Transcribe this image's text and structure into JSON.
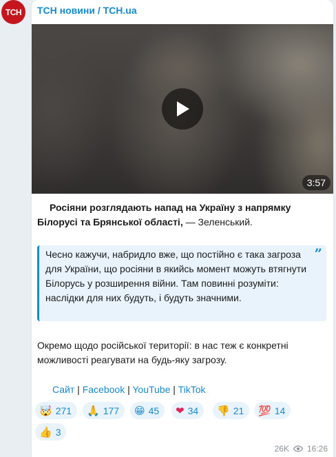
{
  "channel": {
    "avatar_text": "ТСН",
    "name": "ТСН новини / TCH.ua"
  },
  "video": {
    "duration": "3:57",
    "play_icon": "play-icon"
  },
  "message": {
    "headline_bold": "Росіяни розглядають напад на Україну з напрямку Білорусі та Брянської області,",
    "headline_rest": " — Зеленський.",
    "quote": "Чесно кажучи, набридло вже, що постійно є така загроза для України, що росіяни в якийсь момент можуть втягнути Білорусь у розширення війни. Там повинні розуміти: наслідки для них будуть, і будуть значними.",
    "quote_mark": "”",
    "paragraph": "Окремо щодо російської території: в нас теж є конкретні можливості реагувати на будь-яку загрозу."
  },
  "links": [
    {
      "label": "Сайт"
    },
    {
      "label": "Facebook"
    },
    {
      "label": "YouTube"
    },
    {
      "label": "TikTok"
    }
  ],
  "link_separator": " | ",
  "reactions": [
    {
      "emoji": "🤯",
      "count": "271"
    },
    {
      "emoji": "🙏",
      "count": "177"
    },
    {
      "emoji": "😁",
      "count": "45"
    },
    {
      "emoji": "❤",
      "count": "34"
    },
    {
      "emoji": "👎",
      "count": "21"
    },
    {
      "emoji": "💯",
      "count": "14"
    },
    {
      "emoji": "👍",
      "count": "3"
    }
  ],
  "meta": {
    "views": "26K",
    "time": "16:26",
    "views_icon": "eye-icon"
  },
  "colors": {
    "accent": "#168acd",
    "avatar_bg": "#c4161c",
    "chat_bg": "#e9eef2"
  }
}
